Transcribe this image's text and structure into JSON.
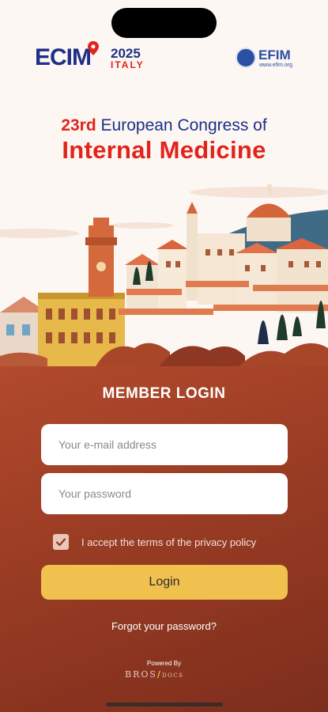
{
  "header": {
    "ecim_logo_text": "ECIM",
    "ecim_year": "2025",
    "ecim_country": "ITALY",
    "efim_logo_text": "EFIM",
    "efim_url": "www.efim.org"
  },
  "congress": {
    "edition": "23rd",
    "title_line1": "European Congress of",
    "title_line2": "Internal Medicine"
  },
  "login": {
    "heading": "MEMBER LOGIN",
    "email_placeholder": "Your e-mail address",
    "email_value": "",
    "password_placeholder": "Your password",
    "password_value": "",
    "privacy_checked": true,
    "privacy_label": "I accept the terms of the privacy policy",
    "login_label": "Login",
    "forgot_label": "Forgot your password?"
  },
  "footer": {
    "powered_by": "Powered By",
    "brand_main": "BROS",
    "brand_slash": "/",
    "brand_suffix": "DOCS"
  },
  "colors": {
    "navy": "#1e2f86",
    "red": "#e2231a",
    "panel_top": "#b24a2c",
    "panel_bottom": "#7d2e1d",
    "button": "#f0c14e"
  },
  "icons": {
    "checkbox": "check-icon",
    "location": "location-pin-icon",
    "globe": "globe-icon"
  }
}
